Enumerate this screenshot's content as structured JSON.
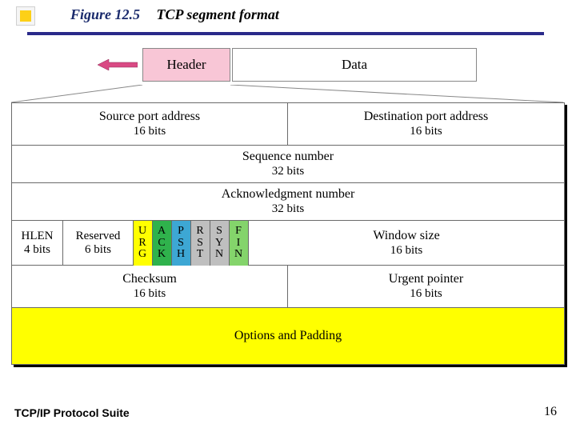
{
  "header": {
    "figure_label": "Figure 12.5",
    "title": "TCP segment format"
  },
  "top": {
    "header_box": "Header",
    "data_box": "Data"
  },
  "row1": {
    "src": {
      "label": "Source port address",
      "bits": "16 bits"
    },
    "dst": {
      "label": "Destination port address",
      "bits": "16 bits"
    }
  },
  "row2": {
    "label": "Sequence number",
    "bits": "32 bits"
  },
  "row3": {
    "label": "Acknowledgment number",
    "bits": "32 bits"
  },
  "row4": {
    "hlen": {
      "label": "HLEN",
      "bits": "4 bits"
    },
    "reserved": {
      "label": "Reserved",
      "bits": "6 bits"
    },
    "flags": {
      "urg": "URG",
      "ack": "ACK",
      "psh": "PSH",
      "rst": "RST",
      "syn": "SYN",
      "fin": "FIN"
    },
    "win": {
      "label": "Window size",
      "bits": "16 bits"
    }
  },
  "row5": {
    "checksum": {
      "label": "Checksum",
      "bits": "16 bits"
    },
    "urgent": {
      "label": "Urgent pointer",
      "bits": "16 bits"
    }
  },
  "row6": {
    "label": "Options and Padding"
  },
  "footer": {
    "left": "TCP/IP Protocol Suite",
    "page": "16"
  },
  "colors": {
    "flag_urg": "#ffff00",
    "flag_ack": "#2fb24c",
    "flag_psh": "#3da7d4",
    "flag_rst": "#bfbfbf",
    "flag_syn": "#bfbfbf",
    "flag_fin": "#84d46b"
  }
}
